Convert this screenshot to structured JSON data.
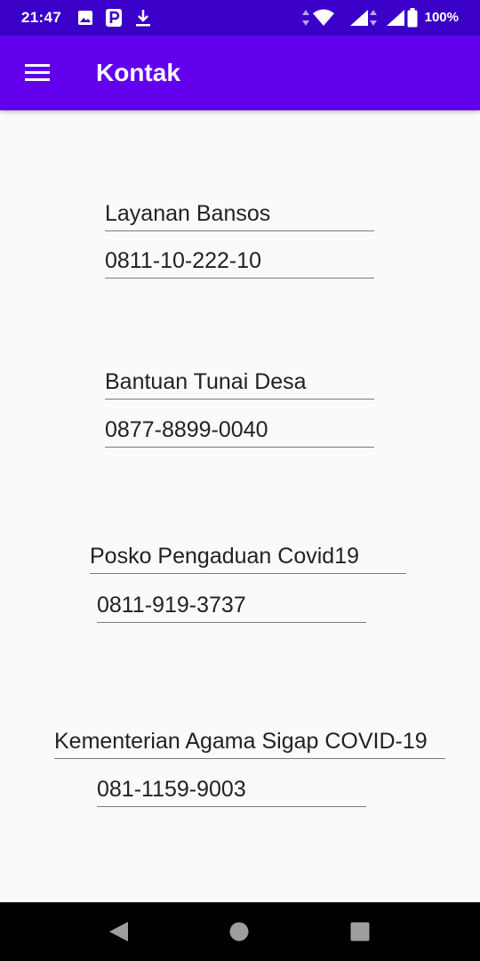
{
  "status_bar": {
    "time": "21:47",
    "battery": "100%",
    "icons": [
      "image-icon",
      "parking-icon",
      "download-icon",
      "data-arrows-icon",
      "wifi-icon",
      "signal-icon",
      "signal-icon",
      "battery-icon"
    ]
  },
  "app_bar": {
    "title": "Kontak",
    "menu_icon": "hamburger-menu-icon",
    "color": "#6200EE"
  },
  "contacts": [
    {
      "name": "Layanan Bansos",
      "phone": "0811-10-222-10"
    },
    {
      "name": "Bantuan Tunai Desa",
      "phone": "0877-8899-0040"
    },
    {
      "name": "Posko Pengaduan Covid19",
      "phone": "0811-919-3737"
    },
    {
      "name": "Kementerian Agama Sigap COVID-19",
      "phone": "081-1159-9003"
    }
  ],
  "nav_bar": {
    "buttons": [
      "back-icon",
      "home-icon",
      "recents-icon"
    ]
  }
}
